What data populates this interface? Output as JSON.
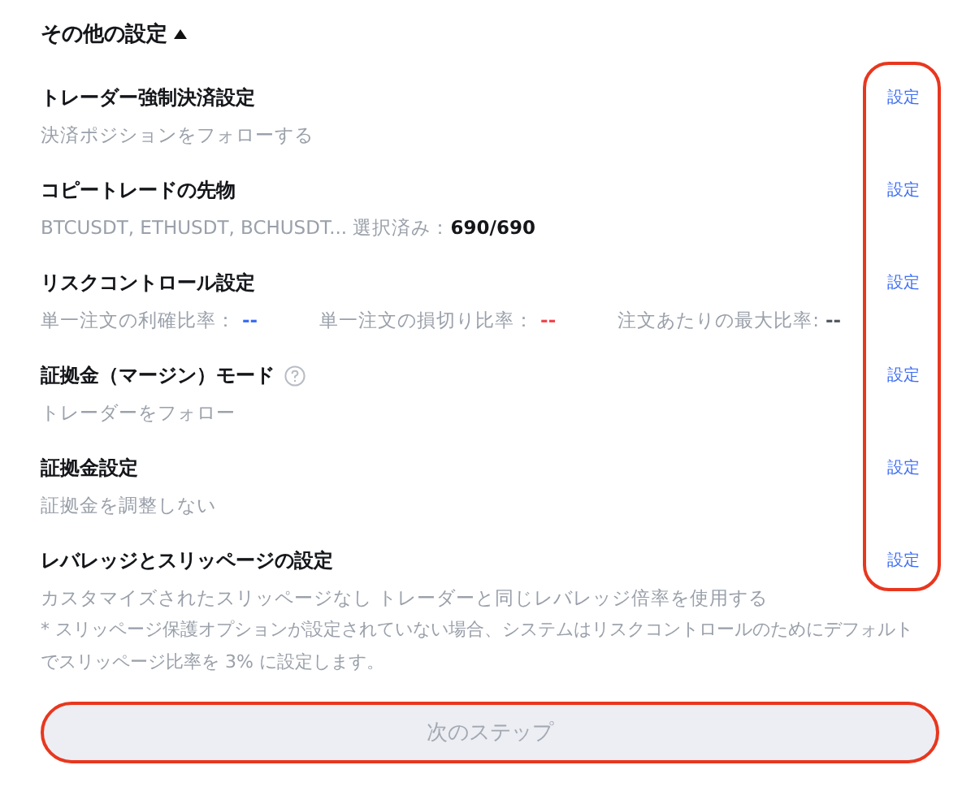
{
  "header": {
    "title": "その他の設定",
    "expanded": true
  },
  "sections": [
    {
      "title": "トレーダー強制決済設定",
      "help": false,
      "link": "設定",
      "details": [
        {
          "kind": "text",
          "text": "決済ポジションをフォローする"
        }
      ]
    },
    {
      "title": "コピートレードの先物",
      "help": false,
      "link": "設定",
      "details": [
        {
          "kind": "symbols",
          "text": "BTCUSDT, ETHUSDT, BCHUSDT... 選択済み：",
          "count": "690/690"
        }
      ]
    },
    {
      "title": "リスクコントロール設定",
      "help": false,
      "link": "設定",
      "details": [
        {
          "kind": "ratios",
          "items": [
            {
              "label": "単一注文の利確比率：",
              "value": "--",
              "color": "#3d6df5"
            },
            {
              "label": "単一注文の損切り比率：",
              "value": "--",
              "color": "#f0474f"
            },
            {
              "label": "注文あたりの最大比率:",
              "value": "--",
              "color": "#555a63"
            }
          ]
        }
      ]
    },
    {
      "title": "証拠金（マージン）モード",
      "help": true,
      "link": "設定",
      "details": [
        {
          "kind": "text",
          "text": "トレーダーをフォロー"
        }
      ]
    },
    {
      "title": "証拠金設定",
      "help": false,
      "link": "設定",
      "details": [
        {
          "kind": "text",
          "text": "証拠金を調整しない"
        }
      ]
    },
    {
      "title": "レバレッジとスリッページの設定",
      "help": false,
      "link": "設定",
      "details": [
        {
          "kind": "text",
          "text": "カスタマイズされたスリッページなし トレーダーと同じレバレッジ倍率を使用する"
        },
        {
          "kind": "note",
          "text": "* スリッページ保護オプションが設定されていない場合、システムはリスクコントロールのためにデフォルトでスリッページ比率を 3% に設定します。"
        }
      ]
    }
  ],
  "next_button": {
    "label": "次のステップ",
    "disabled": true
  },
  "annotations": {
    "links_circled": true,
    "button_circled": true
  }
}
